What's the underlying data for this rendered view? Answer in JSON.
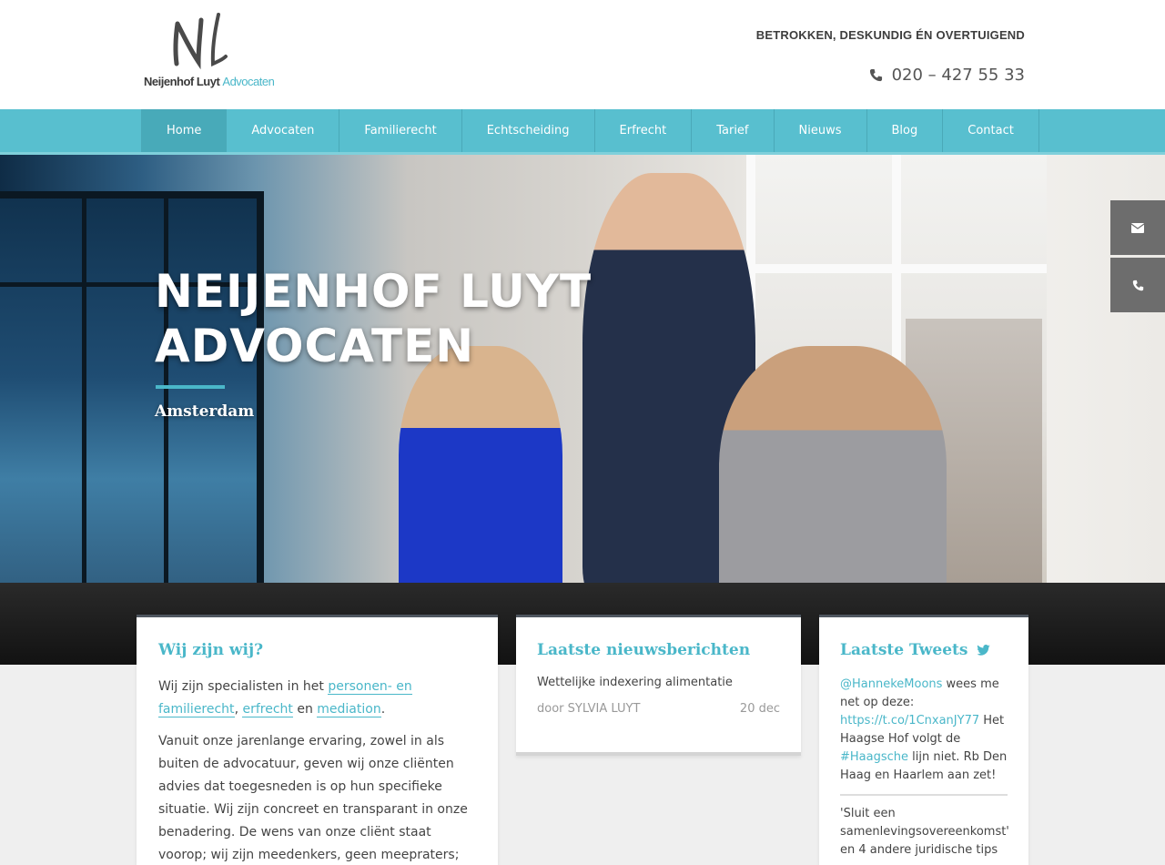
{
  "header": {
    "logo_mark": "NL",
    "logo_name": "Neijenhof Luyt",
    "logo_suffix": "Advocaten",
    "tagline": "BETROKKEN, DESKUNDIG ÉN OVERTUIGEND",
    "phone": "020 – 427 55 33"
  },
  "nav": {
    "items": [
      "Home",
      "Advocaten",
      "Familierecht",
      "Echtscheiding",
      "Erfrecht",
      "Tarief",
      "Nieuws",
      "Blog",
      "Contact"
    ],
    "active": "Home"
  },
  "hero": {
    "title_line1": "NEIJENHOF LUYT",
    "title_line2": "ADVOCATEN",
    "subtitle": "Amsterdam"
  },
  "about": {
    "title": "Wij zijn wij?",
    "intro_prefix": "Wij zijn specialisten in het ",
    "link1": "personen- en familierecht",
    "sep1": ", ",
    "link2": "erfrecht",
    "sep2": " en ",
    "link3": "mediation",
    "end": ".",
    "body": "Vanuit onze jarenlange ervaring, zowel in als buiten de advocatuur, geven wij onze cliënten advies dat toegesneden is op hun specifieke situatie. Wij zijn concreet en transparant in onze benadering. De wens van onze cliënt staat voorop; wij zijn meedenkers, geen meepraters; kritisch"
  },
  "news": {
    "title": "Laatste nieuwsberichten",
    "item_title": "Wettelijke indexering alimentatie",
    "item_author": "door SYLVIA LUYT",
    "item_date": "20 dec"
  },
  "tweets": {
    "title": "Laatste Tweets",
    "t1_handle": "@HannekeMoons",
    "t1_text1": " wees me net op deze: ",
    "t1_link": "https://t.co/1CnxanJY77",
    "t1_text2": " Het Haagse Hof volgt de ",
    "t1_hashtag": "#Haagsche",
    "t1_text3": " lijn niet. Rb Den Haag en Haarlem aan zet!",
    "t2_text": "'Sluit een samenlevingsovereenkomst' en 4 andere juridische tips"
  },
  "colors": {
    "accent": "#4ab7c9",
    "nav": "#58bfcf",
    "side_button": "#6d6d6d"
  },
  "icons": [
    "phone-icon",
    "envelope-icon",
    "phone-icon",
    "twitter-icon"
  ]
}
